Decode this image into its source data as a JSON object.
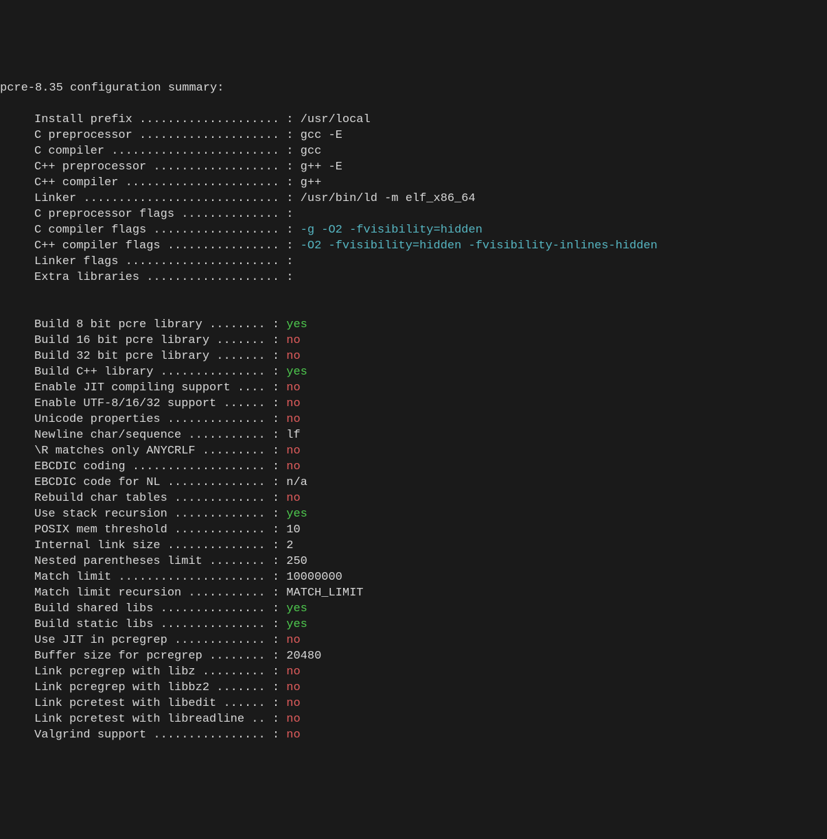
{
  "header": "pcre-8.35 configuration summary:",
  "section1": [
    {
      "label": "Install prefix .................... :",
      "value": "/usr/local",
      "cls": "value-text"
    },
    {
      "label": "C preprocessor .................... :",
      "value": "gcc -E",
      "cls": "value-text"
    },
    {
      "label": "C compiler ........................ :",
      "value": "gcc",
      "cls": "value-text"
    },
    {
      "label": "C++ preprocessor .................. :",
      "value": "g++ -E",
      "cls": "value-text"
    },
    {
      "label": "C++ compiler ...................... :",
      "value": "g++",
      "cls": "value-text"
    },
    {
      "label": "Linker ............................ :",
      "value": "/usr/bin/ld -m elf_x86_64",
      "cls": "value-text"
    },
    {
      "label": "C preprocessor flags .............. :",
      "value": "",
      "cls": "value-text"
    },
    {
      "label": "C compiler flags .................. :",
      "value": "-g -O2 -fvisibility=hidden",
      "cls": "value-opt"
    },
    {
      "label": "C++ compiler flags ................ :",
      "value": "-O2 -fvisibility=hidden -fvisibility-inlines-hidden",
      "cls": "value-opt"
    },
    {
      "label": "Linker flags ...................... :",
      "value": "",
      "cls": "value-text"
    },
    {
      "label": "Extra libraries ................... :",
      "value": "",
      "cls": "value-text"
    }
  ],
  "section2": [
    {
      "label": "Build 8 bit pcre library ........ :",
      "value": "yes",
      "cls": "yes"
    },
    {
      "label": "Build 16 bit pcre library ....... :",
      "value": "no",
      "cls": "no"
    },
    {
      "label": "Build 32 bit pcre library ....... :",
      "value": "no",
      "cls": "no"
    },
    {
      "label": "Build C++ library ............... :",
      "value": "yes",
      "cls": "yes"
    },
    {
      "label": "Enable JIT compiling support .... :",
      "value": "no",
      "cls": "no"
    },
    {
      "label": "Enable UTF-8/16/32 support ...... :",
      "value": "no",
      "cls": "no"
    },
    {
      "label": "Unicode properties .............. :",
      "value": "no",
      "cls": "no"
    },
    {
      "label": "Newline char/sequence ........... :",
      "value": "lf",
      "cls": "value-text"
    },
    {
      "label": "\\R matches only ANYCRLF ......... :",
      "value": "no",
      "cls": "no"
    },
    {
      "label": "EBCDIC coding ................... :",
      "value": "no",
      "cls": "no"
    },
    {
      "label": "EBCDIC code for NL .............. :",
      "value": "n/a",
      "cls": "value-text"
    },
    {
      "label": "Rebuild char tables ............. :",
      "value": "no",
      "cls": "no"
    },
    {
      "label": "Use stack recursion ............. :",
      "value": "yes",
      "cls": "yes"
    },
    {
      "label": "POSIX mem threshold ............. :",
      "value": "10",
      "cls": "value-text"
    },
    {
      "label": "Internal link size .............. :",
      "value": "2",
      "cls": "value-text"
    },
    {
      "label": "Nested parentheses limit ........ :",
      "value": "250",
      "cls": "value-text"
    },
    {
      "label": "Match limit ..................... :",
      "value": "10000000",
      "cls": "value-text"
    },
    {
      "label": "Match limit recursion ........... :",
      "value": "MATCH_LIMIT",
      "cls": "value-text"
    },
    {
      "label": "Build shared libs ............... :",
      "value": "yes",
      "cls": "yes"
    },
    {
      "label": "Build static libs ............... :",
      "value": "yes",
      "cls": "yes"
    },
    {
      "label": "Use JIT in pcregrep ............. :",
      "value": "no",
      "cls": "no"
    },
    {
      "label": "Buffer size for pcregrep ........ :",
      "value": "20480",
      "cls": "value-text"
    },
    {
      "label": "Link pcregrep with libz ......... :",
      "value": "no",
      "cls": "no"
    },
    {
      "label": "Link pcregrep with libbz2 ....... :",
      "value": "no",
      "cls": "no"
    },
    {
      "label": "Link pcretest with libedit ...... :",
      "value": "no",
      "cls": "no"
    },
    {
      "label": "Link pcretest with libreadline .. :",
      "value": "no",
      "cls": "no"
    },
    {
      "label": "Valgrind support ................ :",
      "value": "no",
      "cls": "no"
    }
  ]
}
